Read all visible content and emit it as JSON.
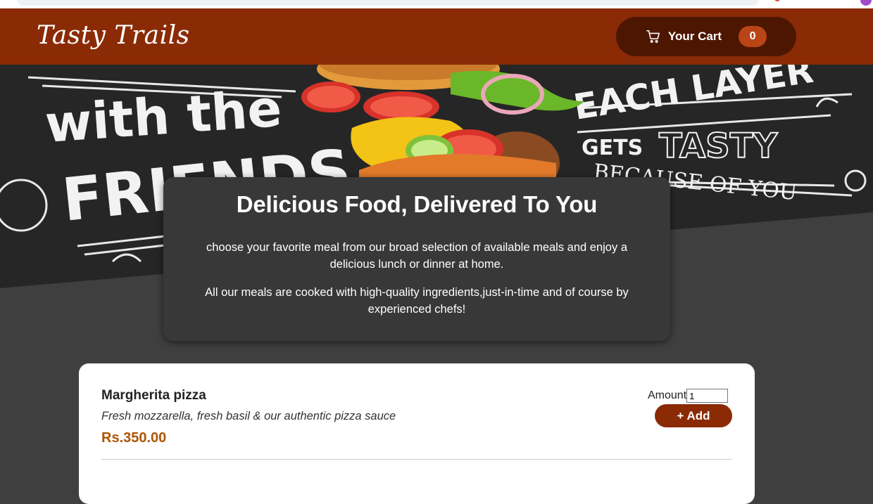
{
  "header": {
    "logo": "Tasty Trails",
    "cart_label": "Your Cart",
    "cart_count": "0",
    "cart_icon": "cart-icon"
  },
  "hero": {
    "banner_text": [
      "with the",
      "FRIENDS",
      "EACH LAYER",
      "GETS",
      "TASTY",
      "BECAUSE OF YOU"
    ]
  },
  "summary": {
    "title": "Delicious Food, Delivered To You",
    "paragraph1": "choose your favorite meal from our broad selection of available meals and enjoy a delicious lunch or dinner at home.",
    "paragraph2": "All our meals are cooked with high-quality ingredients,just-in-time and of course by experienced chefs!"
  },
  "meals": [
    {
      "name": "Margherita pizza",
      "description": "Fresh mozzarella, fresh basil & our authentic pizza sauce",
      "price": "Rs.350.00",
      "amount_label": "Amount",
      "amount_value": "1",
      "add_label": "+ Add"
    }
  ],
  "colors": {
    "header_bg": "#8a2b06",
    "cart_bg": "#4d1601",
    "badge_bg": "#b94517",
    "price": "#ad5502",
    "page_bg": "#3f3f3f"
  }
}
